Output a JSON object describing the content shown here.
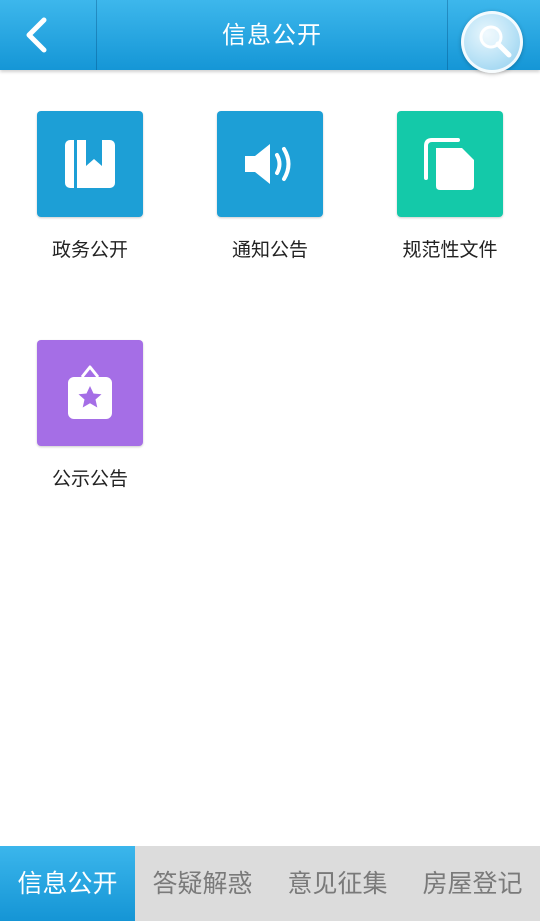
{
  "header": {
    "title": "信息公开",
    "back_icon": "chevron-left-icon",
    "search_icon": "magnifier-icon"
  },
  "grid": {
    "items": [
      {
        "label": "政务公开",
        "icon": "bookmark-book-icon",
        "color": "#1d9fd6"
      },
      {
        "label": "通知公告",
        "icon": "speaker-icon",
        "color": "#1d9fd6"
      },
      {
        "label": "规范性文件",
        "icon": "documents-icon",
        "color": "#14c9a9"
      },
      {
        "label": "公示公告",
        "icon": "star-notice-board-icon",
        "color": "#a56ee6"
      }
    ]
  },
  "tabs": [
    {
      "label": "信息公开",
      "active": true
    },
    {
      "label": "答疑解惑",
      "active": false
    },
    {
      "label": "意见征集",
      "active": false
    },
    {
      "label": "房屋登记",
      "active": false
    }
  ],
  "colors": {
    "header": "#1fa2df",
    "tab_active": "#1fa2df",
    "tab_inactive_bg": "#dcdcdc"
  }
}
